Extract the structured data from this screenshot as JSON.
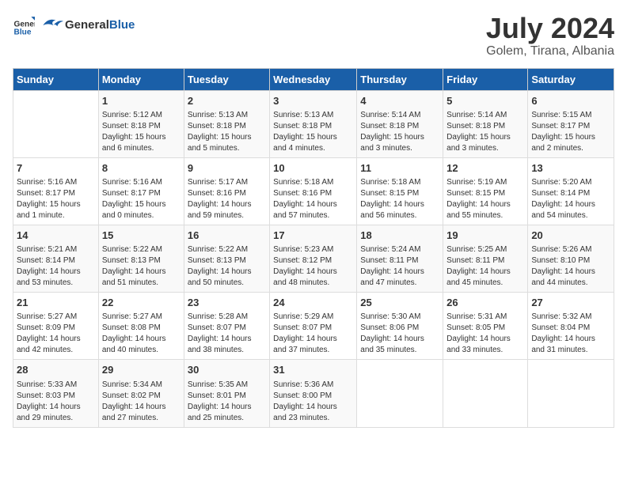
{
  "logo": {
    "general": "General",
    "blue": "Blue"
  },
  "title": "July 2024",
  "location": "Golem, Tirana, Albania",
  "days_of_week": [
    "Sunday",
    "Monday",
    "Tuesday",
    "Wednesday",
    "Thursday",
    "Friday",
    "Saturday"
  ],
  "weeks": [
    [
      {
        "day": "",
        "info": ""
      },
      {
        "day": "1",
        "info": "Sunrise: 5:12 AM\nSunset: 8:18 PM\nDaylight: 15 hours\nand 6 minutes."
      },
      {
        "day": "2",
        "info": "Sunrise: 5:13 AM\nSunset: 8:18 PM\nDaylight: 15 hours\nand 5 minutes."
      },
      {
        "day": "3",
        "info": "Sunrise: 5:13 AM\nSunset: 8:18 PM\nDaylight: 15 hours\nand 4 minutes."
      },
      {
        "day": "4",
        "info": "Sunrise: 5:14 AM\nSunset: 8:18 PM\nDaylight: 15 hours\nand 3 minutes."
      },
      {
        "day": "5",
        "info": "Sunrise: 5:14 AM\nSunset: 8:18 PM\nDaylight: 15 hours\nand 3 minutes."
      },
      {
        "day": "6",
        "info": "Sunrise: 5:15 AM\nSunset: 8:17 PM\nDaylight: 15 hours\nand 2 minutes."
      }
    ],
    [
      {
        "day": "7",
        "info": "Sunrise: 5:16 AM\nSunset: 8:17 PM\nDaylight: 15 hours\nand 1 minute."
      },
      {
        "day": "8",
        "info": "Sunrise: 5:16 AM\nSunset: 8:17 PM\nDaylight: 15 hours\nand 0 minutes."
      },
      {
        "day": "9",
        "info": "Sunrise: 5:17 AM\nSunset: 8:16 PM\nDaylight: 14 hours\nand 59 minutes."
      },
      {
        "day": "10",
        "info": "Sunrise: 5:18 AM\nSunset: 8:16 PM\nDaylight: 14 hours\nand 57 minutes."
      },
      {
        "day": "11",
        "info": "Sunrise: 5:18 AM\nSunset: 8:15 PM\nDaylight: 14 hours\nand 56 minutes."
      },
      {
        "day": "12",
        "info": "Sunrise: 5:19 AM\nSunset: 8:15 PM\nDaylight: 14 hours\nand 55 minutes."
      },
      {
        "day": "13",
        "info": "Sunrise: 5:20 AM\nSunset: 8:14 PM\nDaylight: 14 hours\nand 54 minutes."
      }
    ],
    [
      {
        "day": "14",
        "info": "Sunrise: 5:21 AM\nSunset: 8:14 PM\nDaylight: 14 hours\nand 53 minutes."
      },
      {
        "day": "15",
        "info": "Sunrise: 5:22 AM\nSunset: 8:13 PM\nDaylight: 14 hours\nand 51 minutes."
      },
      {
        "day": "16",
        "info": "Sunrise: 5:22 AM\nSunset: 8:13 PM\nDaylight: 14 hours\nand 50 minutes."
      },
      {
        "day": "17",
        "info": "Sunrise: 5:23 AM\nSunset: 8:12 PM\nDaylight: 14 hours\nand 48 minutes."
      },
      {
        "day": "18",
        "info": "Sunrise: 5:24 AM\nSunset: 8:11 PM\nDaylight: 14 hours\nand 47 minutes."
      },
      {
        "day": "19",
        "info": "Sunrise: 5:25 AM\nSunset: 8:11 PM\nDaylight: 14 hours\nand 45 minutes."
      },
      {
        "day": "20",
        "info": "Sunrise: 5:26 AM\nSunset: 8:10 PM\nDaylight: 14 hours\nand 44 minutes."
      }
    ],
    [
      {
        "day": "21",
        "info": "Sunrise: 5:27 AM\nSunset: 8:09 PM\nDaylight: 14 hours\nand 42 minutes."
      },
      {
        "day": "22",
        "info": "Sunrise: 5:27 AM\nSunset: 8:08 PM\nDaylight: 14 hours\nand 40 minutes."
      },
      {
        "day": "23",
        "info": "Sunrise: 5:28 AM\nSunset: 8:07 PM\nDaylight: 14 hours\nand 38 minutes."
      },
      {
        "day": "24",
        "info": "Sunrise: 5:29 AM\nSunset: 8:07 PM\nDaylight: 14 hours\nand 37 minutes."
      },
      {
        "day": "25",
        "info": "Sunrise: 5:30 AM\nSunset: 8:06 PM\nDaylight: 14 hours\nand 35 minutes."
      },
      {
        "day": "26",
        "info": "Sunrise: 5:31 AM\nSunset: 8:05 PM\nDaylight: 14 hours\nand 33 minutes."
      },
      {
        "day": "27",
        "info": "Sunrise: 5:32 AM\nSunset: 8:04 PM\nDaylight: 14 hours\nand 31 minutes."
      }
    ],
    [
      {
        "day": "28",
        "info": "Sunrise: 5:33 AM\nSunset: 8:03 PM\nDaylight: 14 hours\nand 29 minutes."
      },
      {
        "day": "29",
        "info": "Sunrise: 5:34 AM\nSunset: 8:02 PM\nDaylight: 14 hours\nand 27 minutes."
      },
      {
        "day": "30",
        "info": "Sunrise: 5:35 AM\nSunset: 8:01 PM\nDaylight: 14 hours\nand 25 minutes."
      },
      {
        "day": "31",
        "info": "Sunrise: 5:36 AM\nSunset: 8:00 PM\nDaylight: 14 hours\nand 23 minutes."
      },
      {
        "day": "",
        "info": ""
      },
      {
        "day": "",
        "info": ""
      },
      {
        "day": "",
        "info": ""
      }
    ]
  ]
}
